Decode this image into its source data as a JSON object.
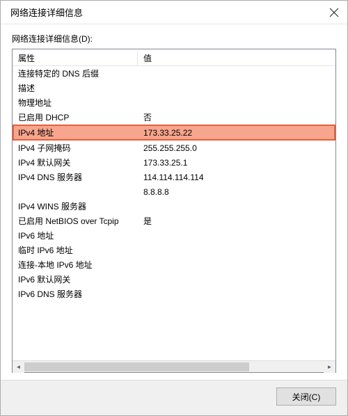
{
  "title": "网络连接详细信息",
  "list_label": "网络连接详细信息(D):",
  "header": {
    "prop": "属性",
    "val": "值"
  },
  "rows": [
    {
      "prop": "连接特定的 DNS 后缀",
      "val": ""
    },
    {
      "prop": "描述",
      "val": ""
    },
    {
      "prop": "物理地址",
      "val": ""
    },
    {
      "prop": "已启用 DHCP",
      "val": "否"
    },
    {
      "prop": "IPv4 地址",
      "val": "173.33.25.22",
      "highlighted": true
    },
    {
      "prop": "IPv4 子网掩码",
      "val": "255.255.255.0"
    },
    {
      "prop": "IPv4 默认网关",
      "val": "173.33.25.1"
    },
    {
      "prop": "IPv4 DNS 服务器",
      "val": "114.114.114.114"
    },
    {
      "prop": "",
      "val": "8.8.8.8"
    },
    {
      "prop": "IPv4 WINS 服务器",
      "val": ""
    },
    {
      "prop": "已启用 NetBIOS over Tcpip",
      "val": "是"
    },
    {
      "prop": "IPv6 地址",
      "val": ""
    },
    {
      "prop": "临时 IPv6 地址",
      "val": ""
    },
    {
      "prop": "连接-本地 IPv6 地址",
      "val": ""
    },
    {
      "prop": "IPv6 默认网关",
      "val": ""
    },
    {
      "prop": "IPv6 DNS 服务器",
      "val": ""
    }
  ],
  "close_button": "关闭(C)"
}
